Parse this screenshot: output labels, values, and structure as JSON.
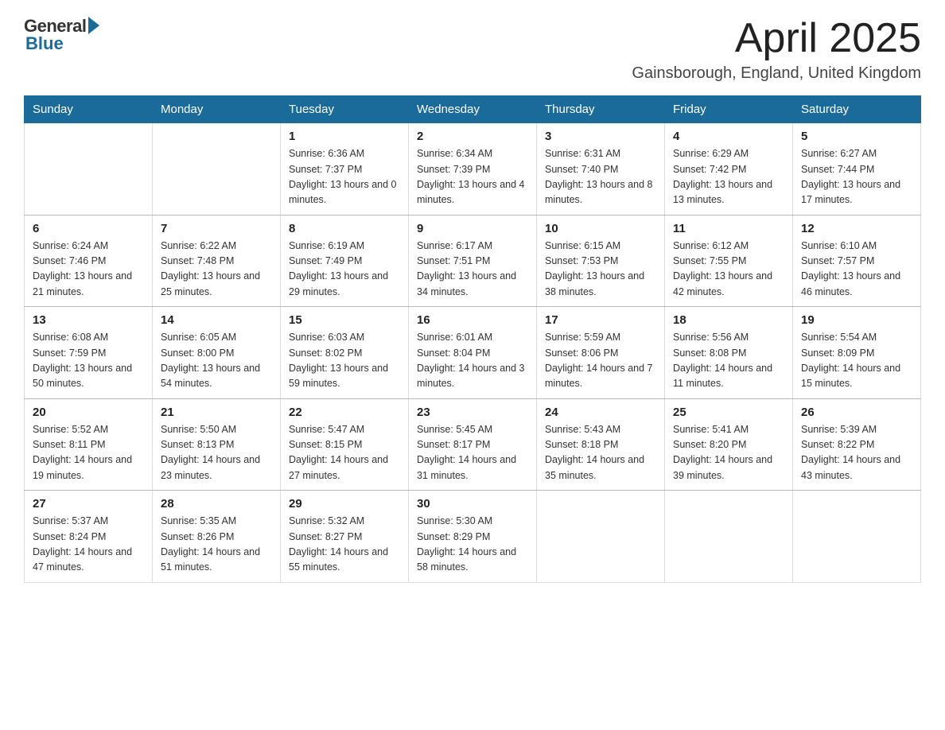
{
  "logo": {
    "general": "General",
    "blue": "Blue"
  },
  "header": {
    "month": "April 2025",
    "location": "Gainsborough, England, United Kingdom"
  },
  "days_of_week": [
    "Sunday",
    "Monday",
    "Tuesday",
    "Wednesday",
    "Thursday",
    "Friday",
    "Saturday"
  ],
  "weeks": [
    [
      {
        "day": "",
        "sunrise": "",
        "sunset": "",
        "daylight": ""
      },
      {
        "day": "",
        "sunrise": "",
        "sunset": "",
        "daylight": ""
      },
      {
        "day": "1",
        "sunrise": "Sunrise: 6:36 AM",
        "sunset": "Sunset: 7:37 PM",
        "daylight": "Daylight: 13 hours and 0 minutes."
      },
      {
        "day": "2",
        "sunrise": "Sunrise: 6:34 AM",
        "sunset": "Sunset: 7:39 PM",
        "daylight": "Daylight: 13 hours and 4 minutes."
      },
      {
        "day": "3",
        "sunrise": "Sunrise: 6:31 AM",
        "sunset": "Sunset: 7:40 PM",
        "daylight": "Daylight: 13 hours and 8 minutes."
      },
      {
        "day": "4",
        "sunrise": "Sunrise: 6:29 AM",
        "sunset": "Sunset: 7:42 PM",
        "daylight": "Daylight: 13 hours and 13 minutes."
      },
      {
        "day": "5",
        "sunrise": "Sunrise: 6:27 AM",
        "sunset": "Sunset: 7:44 PM",
        "daylight": "Daylight: 13 hours and 17 minutes."
      }
    ],
    [
      {
        "day": "6",
        "sunrise": "Sunrise: 6:24 AM",
        "sunset": "Sunset: 7:46 PM",
        "daylight": "Daylight: 13 hours and 21 minutes."
      },
      {
        "day": "7",
        "sunrise": "Sunrise: 6:22 AM",
        "sunset": "Sunset: 7:48 PM",
        "daylight": "Daylight: 13 hours and 25 minutes."
      },
      {
        "day": "8",
        "sunrise": "Sunrise: 6:19 AM",
        "sunset": "Sunset: 7:49 PM",
        "daylight": "Daylight: 13 hours and 29 minutes."
      },
      {
        "day": "9",
        "sunrise": "Sunrise: 6:17 AM",
        "sunset": "Sunset: 7:51 PM",
        "daylight": "Daylight: 13 hours and 34 minutes."
      },
      {
        "day": "10",
        "sunrise": "Sunrise: 6:15 AM",
        "sunset": "Sunset: 7:53 PM",
        "daylight": "Daylight: 13 hours and 38 minutes."
      },
      {
        "day": "11",
        "sunrise": "Sunrise: 6:12 AM",
        "sunset": "Sunset: 7:55 PM",
        "daylight": "Daylight: 13 hours and 42 minutes."
      },
      {
        "day": "12",
        "sunrise": "Sunrise: 6:10 AM",
        "sunset": "Sunset: 7:57 PM",
        "daylight": "Daylight: 13 hours and 46 minutes."
      }
    ],
    [
      {
        "day": "13",
        "sunrise": "Sunrise: 6:08 AM",
        "sunset": "Sunset: 7:59 PM",
        "daylight": "Daylight: 13 hours and 50 minutes."
      },
      {
        "day": "14",
        "sunrise": "Sunrise: 6:05 AM",
        "sunset": "Sunset: 8:00 PM",
        "daylight": "Daylight: 13 hours and 54 minutes."
      },
      {
        "day": "15",
        "sunrise": "Sunrise: 6:03 AM",
        "sunset": "Sunset: 8:02 PM",
        "daylight": "Daylight: 13 hours and 59 minutes."
      },
      {
        "day": "16",
        "sunrise": "Sunrise: 6:01 AM",
        "sunset": "Sunset: 8:04 PM",
        "daylight": "Daylight: 14 hours and 3 minutes."
      },
      {
        "day": "17",
        "sunrise": "Sunrise: 5:59 AM",
        "sunset": "Sunset: 8:06 PM",
        "daylight": "Daylight: 14 hours and 7 minutes."
      },
      {
        "day": "18",
        "sunrise": "Sunrise: 5:56 AM",
        "sunset": "Sunset: 8:08 PM",
        "daylight": "Daylight: 14 hours and 11 minutes."
      },
      {
        "day": "19",
        "sunrise": "Sunrise: 5:54 AM",
        "sunset": "Sunset: 8:09 PM",
        "daylight": "Daylight: 14 hours and 15 minutes."
      }
    ],
    [
      {
        "day": "20",
        "sunrise": "Sunrise: 5:52 AM",
        "sunset": "Sunset: 8:11 PM",
        "daylight": "Daylight: 14 hours and 19 minutes."
      },
      {
        "day": "21",
        "sunrise": "Sunrise: 5:50 AM",
        "sunset": "Sunset: 8:13 PM",
        "daylight": "Daylight: 14 hours and 23 minutes."
      },
      {
        "day": "22",
        "sunrise": "Sunrise: 5:47 AM",
        "sunset": "Sunset: 8:15 PM",
        "daylight": "Daylight: 14 hours and 27 minutes."
      },
      {
        "day": "23",
        "sunrise": "Sunrise: 5:45 AM",
        "sunset": "Sunset: 8:17 PM",
        "daylight": "Daylight: 14 hours and 31 minutes."
      },
      {
        "day": "24",
        "sunrise": "Sunrise: 5:43 AM",
        "sunset": "Sunset: 8:18 PM",
        "daylight": "Daylight: 14 hours and 35 minutes."
      },
      {
        "day": "25",
        "sunrise": "Sunrise: 5:41 AM",
        "sunset": "Sunset: 8:20 PM",
        "daylight": "Daylight: 14 hours and 39 minutes."
      },
      {
        "day": "26",
        "sunrise": "Sunrise: 5:39 AM",
        "sunset": "Sunset: 8:22 PM",
        "daylight": "Daylight: 14 hours and 43 minutes."
      }
    ],
    [
      {
        "day": "27",
        "sunrise": "Sunrise: 5:37 AM",
        "sunset": "Sunset: 8:24 PM",
        "daylight": "Daylight: 14 hours and 47 minutes."
      },
      {
        "day": "28",
        "sunrise": "Sunrise: 5:35 AM",
        "sunset": "Sunset: 8:26 PM",
        "daylight": "Daylight: 14 hours and 51 minutes."
      },
      {
        "day": "29",
        "sunrise": "Sunrise: 5:32 AM",
        "sunset": "Sunset: 8:27 PM",
        "daylight": "Daylight: 14 hours and 55 minutes."
      },
      {
        "day": "30",
        "sunrise": "Sunrise: 5:30 AM",
        "sunset": "Sunset: 8:29 PM",
        "daylight": "Daylight: 14 hours and 58 minutes."
      },
      {
        "day": "",
        "sunrise": "",
        "sunset": "",
        "daylight": ""
      },
      {
        "day": "",
        "sunrise": "",
        "sunset": "",
        "daylight": ""
      },
      {
        "day": "",
        "sunrise": "",
        "sunset": "",
        "daylight": ""
      }
    ]
  ]
}
